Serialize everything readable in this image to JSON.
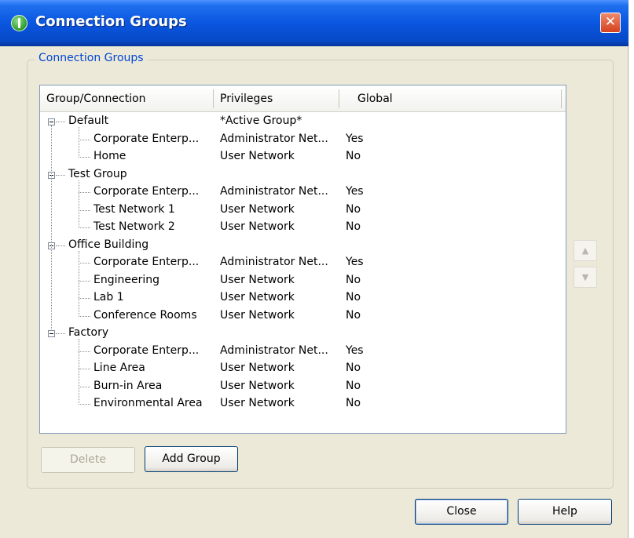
{
  "window": {
    "title": "Connection Groups",
    "close_glyph": "✕"
  },
  "groupbox": {
    "title": "Connection Groups"
  },
  "table": {
    "columns": [
      "Group/Connection",
      "Privileges",
      "Global"
    ],
    "rows": [
      {
        "type": "group",
        "name": "Default",
        "privileges": "*Active Group*",
        "global": ""
      },
      {
        "type": "connection",
        "name": "Corporate Enterp...",
        "privileges": "Administrator Net...",
        "global": "Yes"
      },
      {
        "type": "connection",
        "name": "Home",
        "privileges": "User Network",
        "global": "No"
      },
      {
        "type": "group",
        "name": "Test Group",
        "privileges": "",
        "global": ""
      },
      {
        "type": "connection",
        "name": "Corporate Enterp...",
        "privileges": "Administrator Net...",
        "global": "Yes"
      },
      {
        "type": "connection",
        "name": "Test Network 1",
        "privileges": "User Network",
        "global": "No"
      },
      {
        "type": "connection",
        "name": "Test Network 2",
        "privileges": "User Network",
        "global": "No"
      },
      {
        "type": "group",
        "name": "Office Building",
        "privileges": "",
        "global": ""
      },
      {
        "type": "connection",
        "name": "Corporate Enterp...",
        "privileges": "Administrator Net...",
        "global": "Yes"
      },
      {
        "type": "connection",
        "name": "Engineering",
        "privileges": "User Network",
        "global": "No"
      },
      {
        "type": "connection",
        "name": "Lab 1",
        "privileges": "User Network",
        "global": "No"
      },
      {
        "type": "connection",
        "name": "Conference Rooms",
        "privileges": "User Network",
        "global": "No"
      },
      {
        "type": "group",
        "name": "Factory",
        "privileges": "",
        "global": ""
      },
      {
        "type": "connection",
        "name": "Corporate Enterp...",
        "privileges": "Administrator Net...",
        "global": "Yes"
      },
      {
        "type": "connection",
        "name": "Line Area",
        "privileges": "User Network",
        "global": "No"
      },
      {
        "type": "connection",
        "name": "Burn-in Area",
        "privileges": "User Network",
        "global": "No"
      },
      {
        "type": "connection",
        "name": "Environmental Area",
        "privileges": "User Network",
        "global": "No"
      }
    ]
  },
  "side_buttons": {
    "up_glyph": "▲",
    "down_glyph": "▼"
  },
  "buttons": {
    "delete": "Delete",
    "add_group": "Add Group",
    "close": "Close",
    "help": "Help"
  },
  "icons": {
    "title_icon": "connection-app-icon",
    "close": "close-icon",
    "expander": "collapse-minus-icon"
  },
  "colors": {
    "titlebar": "#0a56e0",
    "close_button": "#d4411f",
    "groupbox_title": "#0046d5",
    "dialog_bg": "#ece9d8"
  }
}
